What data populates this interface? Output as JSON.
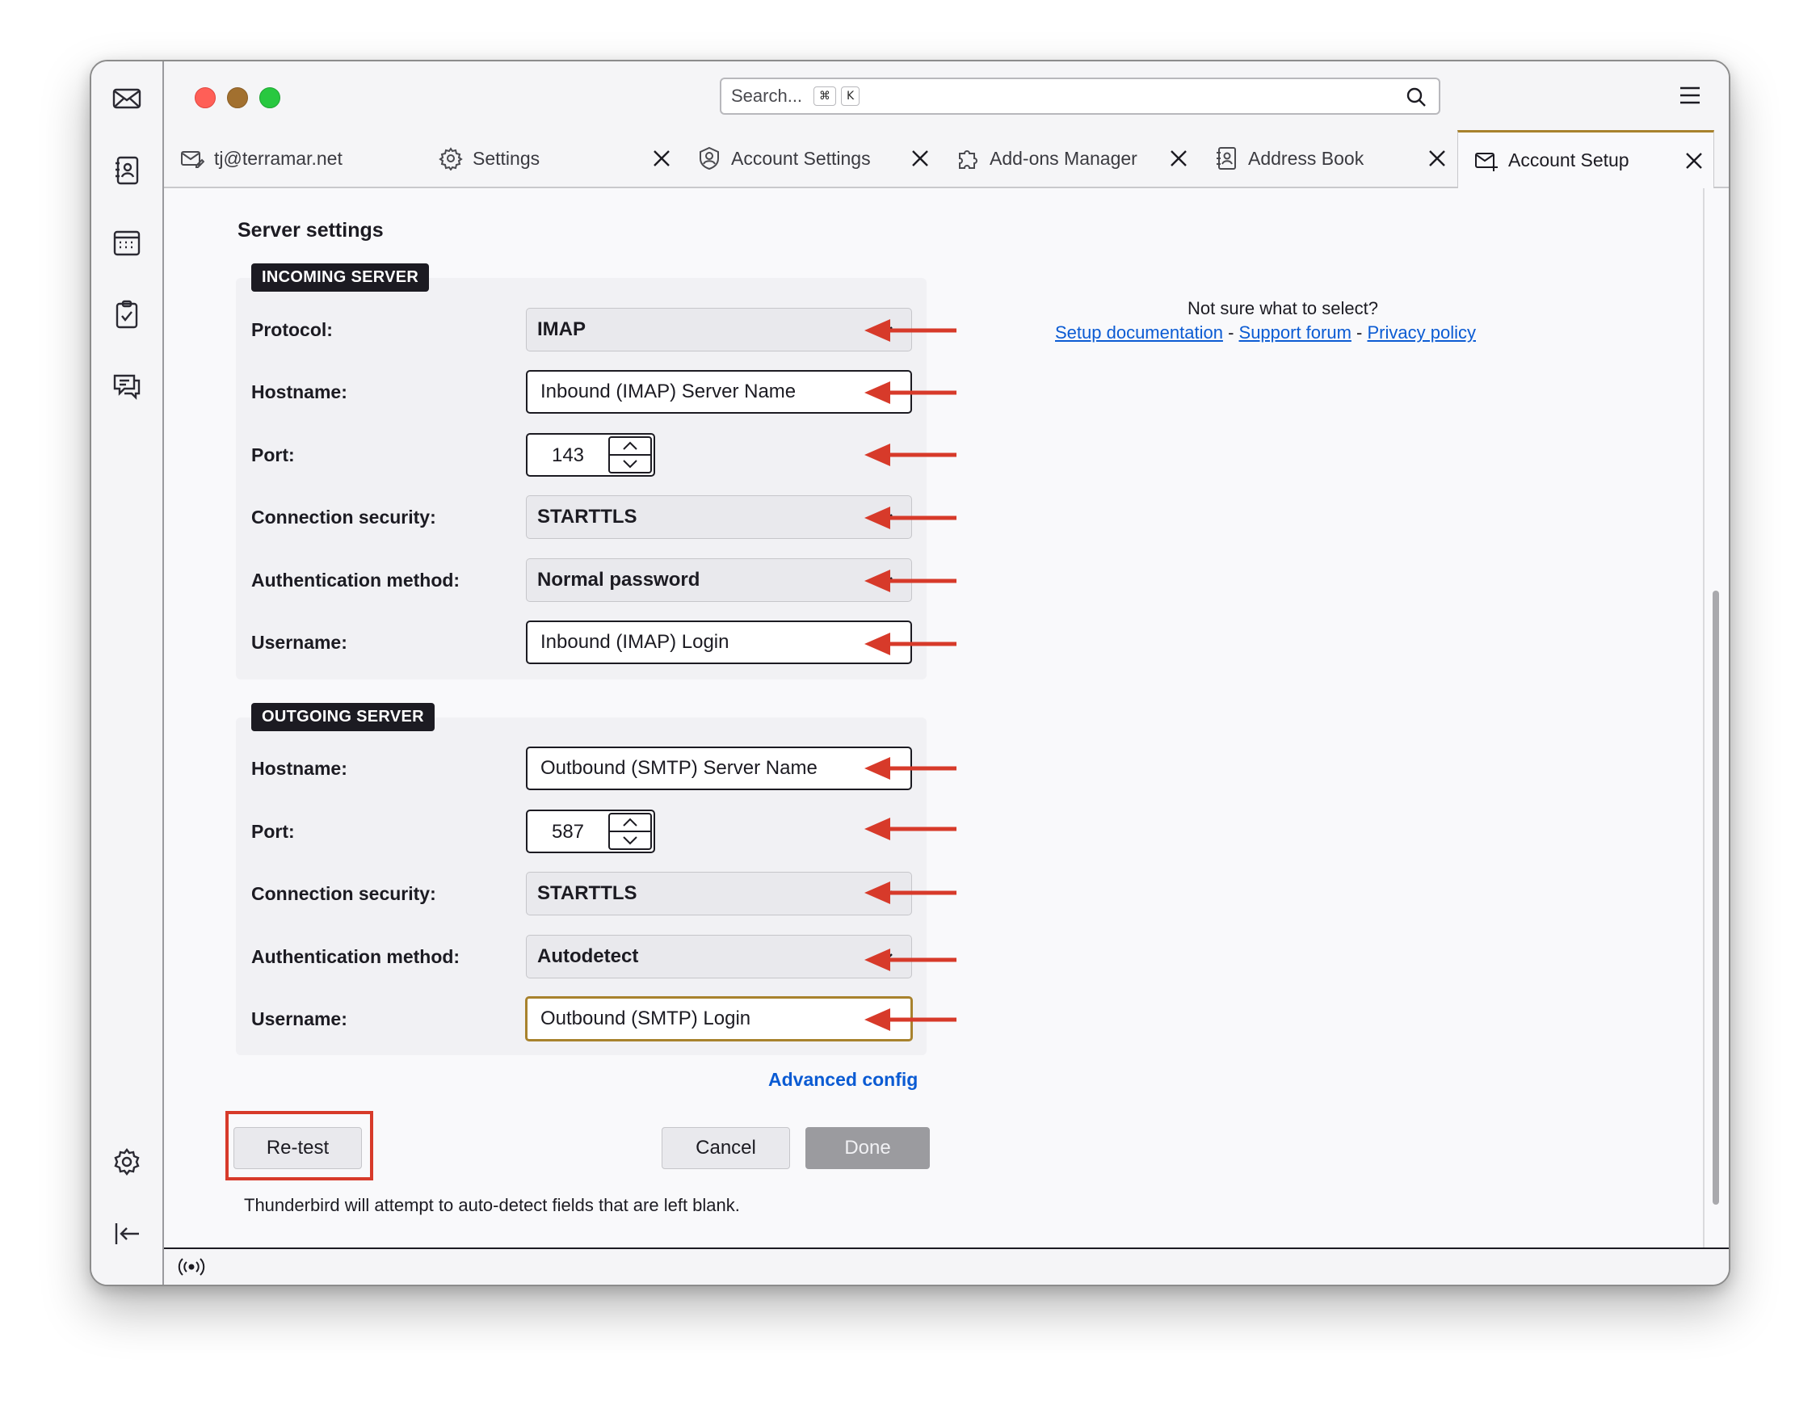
{
  "window": {
    "title": "Account Setup"
  },
  "colors": {
    "accent": "#a8822d",
    "link": "#0b5bd3",
    "arrow": "#d73a2a",
    "close": "#ff5f57",
    "minimize": "#a2702f",
    "zoom": "#28c840"
  },
  "spaces": [
    {
      "icon": "mail-icon"
    },
    {
      "icon": "address-book-icon"
    },
    {
      "icon": "calendar-icon"
    },
    {
      "icon": "tasks-icon"
    },
    {
      "icon": "chat-icon"
    },
    {
      "icon": "settings-gear-icon"
    },
    {
      "icon": "collapse-sidebar-icon"
    }
  ],
  "search": {
    "placeholder": "Search...",
    "shortcut_mod": "⌘",
    "shortcut_key": "K"
  },
  "tabs": [
    {
      "label": "tj@terramar.net",
      "icon": "mail-edit-icon"
    },
    {
      "label": "Settings",
      "icon": "gear-icon"
    },
    {
      "label": "Account Settings",
      "icon": "account-shield-icon"
    },
    {
      "label": "Add-ons Manager",
      "icon": "puzzle-icon"
    },
    {
      "label": "Address Book",
      "icon": "address-book-icon"
    },
    {
      "label": "Account Setup",
      "icon": "account-setup-icon",
      "active": true
    }
  ],
  "server_settings": {
    "title": "Server settings",
    "incoming": {
      "badge": "INCOMING SERVER",
      "protocol_label": "Protocol:",
      "protocol": "IMAP",
      "hostname_label": "Hostname:",
      "hostname": "Inbound (IMAP) Server Name",
      "port_label": "Port:",
      "port": "143",
      "security_label": "Connection security:",
      "security": "STARTTLS",
      "auth_label": "Authentication method:",
      "auth": "Normal password",
      "username_label": "Username:",
      "username": "Inbound (IMAP) Login"
    },
    "outgoing": {
      "badge": "OUTGOING SERVER",
      "hostname_label": "Hostname:",
      "hostname": "Outbound (SMTP) Server Name",
      "port_label": "Port:",
      "port": "587",
      "security_label": "Connection security:",
      "security": "STARTTLS",
      "auth_label": "Authentication method:",
      "auth": "Autodetect",
      "username_label": "Username:",
      "username": "Outbound (SMTP) Login"
    }
  },
  "help": {
    "title": "Not sure what to select?",
    "setup_docs": "Setup documentation",
    "sep": "-",
    "support_forum": "Support forum",
    "privacy_policy": "Privacy policy"
  },
  "advanced_config": "Advanced config",
  "buttons": {
    "retest": "Re-test",
    "cancel": "Cancel",
    "done": "Done"
  },
  "footnote": "Thunderbird will attempt to auto-detect fields that are left blank."
}
